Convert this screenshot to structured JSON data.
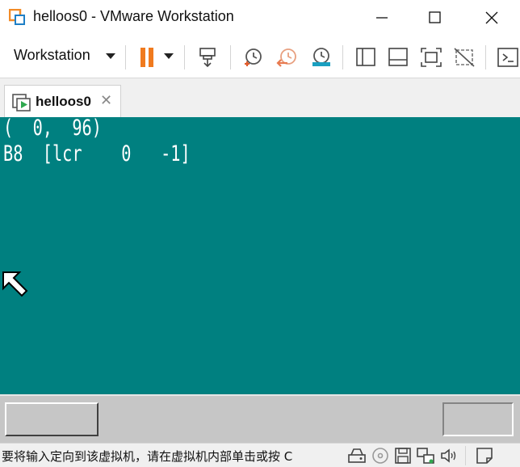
{
  "window": {
    "title": "helloos0 - VMware Workstation"
  },
  "toolbar": {
    "workstation_menu_label": "Workstation",
    "pause_color": "#f07a1e",
    "icons": [
      "pause-icon",
      "send-ctrl-alt-del-icon",
      "snapshot-take-icon",
      "snapshot-revert-icon",
      "snapshot-manager-icon",
      "sidebar-toggle-icon",
      "console-view-icon",
      "fullscreen-icon",
      "unity-icon",
      "console-icon"
    ]
  },
  "tabs": [
    {
      "label": "helloos0",
      "close_glyph": "✕"
    }
  ],
  "guest": {
    "background": "#008080",
    "lines": [
      "(  0,  96)",
      "B8  [lcr    0   -1]"
    ]
  },
  "statusbar": {
    "message": "要将输入定向到该虚拟机，请在虚拟机内部单击或按 C",
    "icons": [
      "hard-disk-icon",
      "cd-dvd-icon",
      "floppy-icon",
      "network-adapter-icon",
      "sound-icon",
      "message-log-icon"
    ]
  }
}
